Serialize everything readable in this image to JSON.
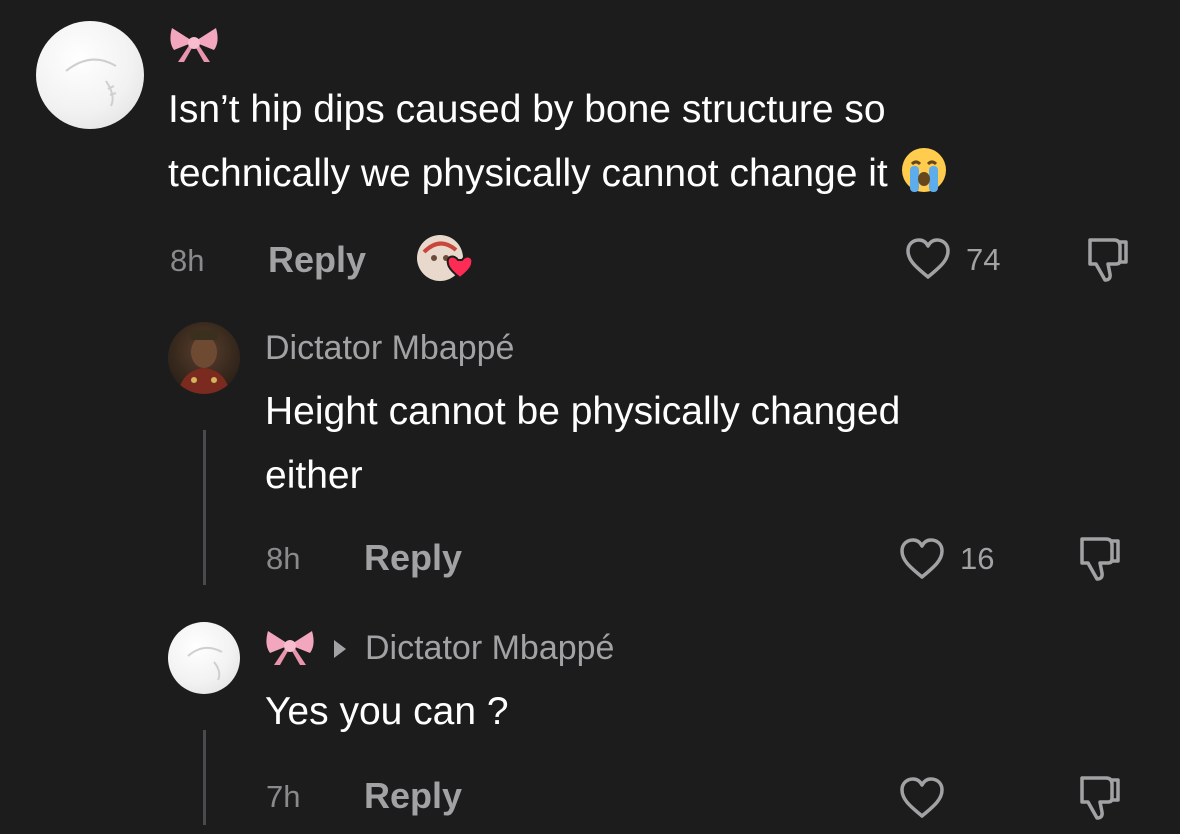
{
  "comments": [
    {
      "username": "",
      "text_lines": [
        "Isn’t hip dips caused by bone structure so",
        "technically we physically cannot change it"
      ],
      "emoji": "loudly-crying-face",
      "time": "8h",
      "reply_label": "Reply",
      "likes": "74",
      "liked_by_creator": true
    },
    {
      "username": "Dictator Mbappé",
      "text_lines": [
        "Height cannot be physically changed",
        "either"
      ],
      "time": "8h",
      "reply_label": "Reply",
      "likes": "16"
    },
    {
      "username": "",
      "reply_to": "Dictator Mbappé",
      "text_lines": [
        "Yes you can ?"
      ],
      "time": "7h",
      "reply_label": "Reply",
      "likes": ""
    }
  ],
  "icons": {
    "bow": "pink-ribbon-bow-icon",
    "heart": "heart-outline-icon",
    "dislike": "thumbs-down-icon",
    "creator_liked": "creator-liked-heart-icon"
  },
  "colors": {
    "background": "#1c1c1d",
    "text": "#ffffff",
    "muted": "#a2a2a4",
    "bow": "#f2a7be",
    "creator_heart": "#fe2c55"
  }
}
